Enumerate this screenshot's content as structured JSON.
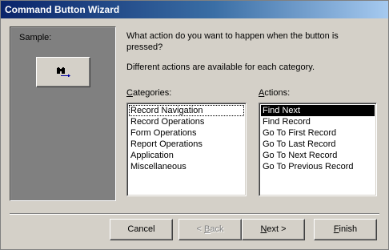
{
  "window": {
    "title": "Command Button Wizard"
  },
  "sample": {
    "label": "Sample:",
    "button_icon": "binoculars-arrow-icon"
  },
  "prompt": {
    "question": "What action do you want to happen when the button is pressed?",
    "hint": "Different actions are available for each category."
  },
  "categories": {
    "label_key": "C",
    "label_rest": "ategories:",
    "items": [
      {
        "label": "Record Navigation",
        "selected": true
      },
      {
        "label": "Record Operations",
        "selected": false
      },
      {
        "label": "Form Operations",
        "selected": false
      },
      {
        "label": "Report Operations",
        "selected": false
      },
      {
        "label": "Application",
        "selected": false
      },
      {
        "label": "Miscellaneous",
        "selected": false
      }
    ]
  },
  "actions": {
    "label_key": "A",
    "label_rest": "ctions:",
    "items": [
      {
        "label": "Find Next",
        "selected": true
      },
      {
        "label": "Find Record",
        "selected": false
      },
      {
        "label": "Go To First Record",
        "selected": false
      },
      {
        "label": "Go To Last Record",
        "selected": false
      },
      {
        "label": "Go To Next Record",
        "selected": false
      },
      {
        "label": "Go To Previous Record",
        "selected": false
      }
    ]
  },
  "buttons": {
    "cancel": "Cancel",
    "back_prefix": "< ",
    "back_key": "B",
    "back_rest": "ack",
    "next_key": "N",
    "next_rest": "ext >",
    "finish_key": "F",
    "finish_rest": "inish"
  },
  "colors": {
    "titlebar_start": "#0a246a",
    "titlebar_end": "#a6caf0",
    "dialog_bg": "#d4d0c8",
    "sample_bg": "#808080"
  }
}
